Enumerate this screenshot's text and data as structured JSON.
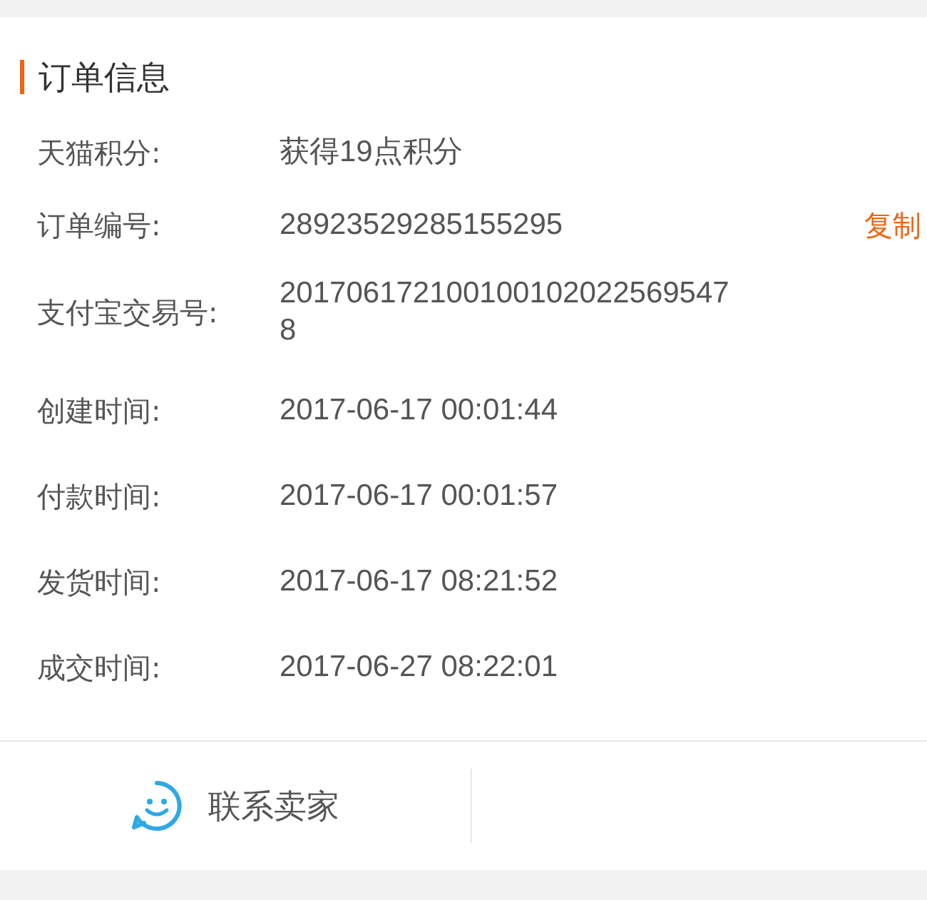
{
  "section": {
    "title": "订单信息"
  },
  "rows": [
    {
      "label": "天猫积分:",
      "value": "获得19点积分"
    },
    {
      "label": "订单编号:",
      "value": "28923529285155295",
      "action": "复制"
    },
    {
      "label": "支付宝交易号:",
      "value": "2017061721001001020225695478"
    },
    {
      "label": "创建时间:",
      "value": "2017-06-17 00:01:44"
    },
    {
      "label": "付款时间:",
      "value": "2017-06-17 00:01:57"
    },
    {
      "label": "发货时间:",
      "value": "2017-06-17 08:21:52"
    },
    {
      "label": "成交时间:",
      "value": "2017-06-27 08:22:01"
    }
  ],
  "footer": {
    "contact_button": "联系卖家"
  }
}
